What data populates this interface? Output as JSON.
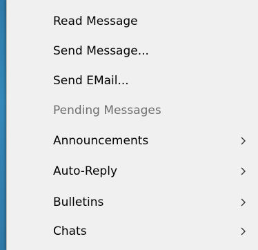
{
  "menu": {
    "items": [
      {
        "label": "Read Message",
        "disabled": false,
        "submenu": false
      },
      {
        "label": "Send Message...",
        "disabled": false,
        "submenu": false
      },
      {
        "label": "Send EMail...",
        "disabled": false,
        "submenu": false
      },
      {
        "label": "Pending Messages",
        "disabled": true,
        "submenu": false
      },
      {
        "label": "Announcements",
        "disabled": false,
        "submenu": true
      },
      {
        "label": "Auto-Reply",
        "disabled": false,
        "submenu": true
      },
      {
        "label": "Bulletins",
        "disabled": false,
        "submenu": true
      },
      {
        "label": "Chats",
        "disabled": false,
        "submenu": true
      }
    ],
    "submenu_icon": "chevron-right-icon",
    "colors": {
      "background": "#f0f0f0",
      "text": "#000000",
      "disabled_text": "#6d6d6d",
      "desktop": "#2e7aa8"
    }
  }
}
